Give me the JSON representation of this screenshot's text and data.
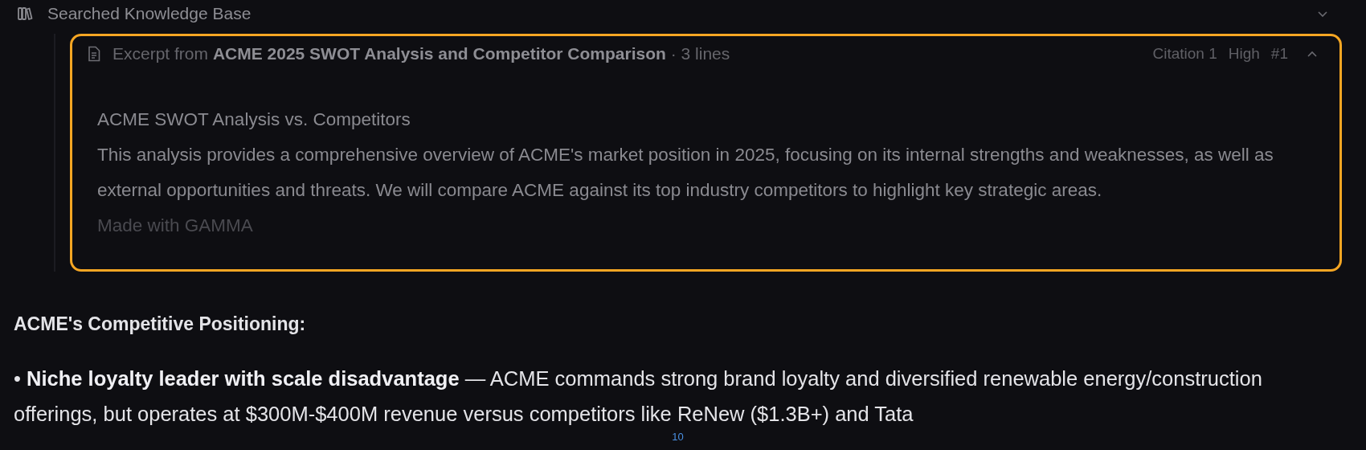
{
  "section": {
    "title": "Searched Knowledge Base"
  },
  "excerpt": {
    "header": "Excerpt from **ACME 2025 SWOT Analysis and Competitor Comparison** · 3 lines",
    "citation": "Citation 1",
    "confidence": "High",
    "rank": "#1",
    "expanded": true,
    "highlighted": true,
    "heading": "ACME SWOT Analysis vs. Competitors",
    "body": "This analysis provides a comprehensive overview of ACME's market position in 2025, focusing on its internal strengths and weaknesses, as well as external opportunities and threats. We will compare ACME against its top industry competitors to highlight key strategic areas.",
    "footer": "Made with GAMMA"
  },
  "answer": {
    "heading": "ACME's Competitive Positioning:",
    "bullets": [
      "• **Niche loyalty leader with scale disadvantage** — ACME commands strong brand loyalty and diversified renewable energy/construction offerings, but operates at $300M-$400M revenue versus competitors like ReNew ($1.3B+) and Tata"
    ],
    "citation_badge": "10"
  }
}
